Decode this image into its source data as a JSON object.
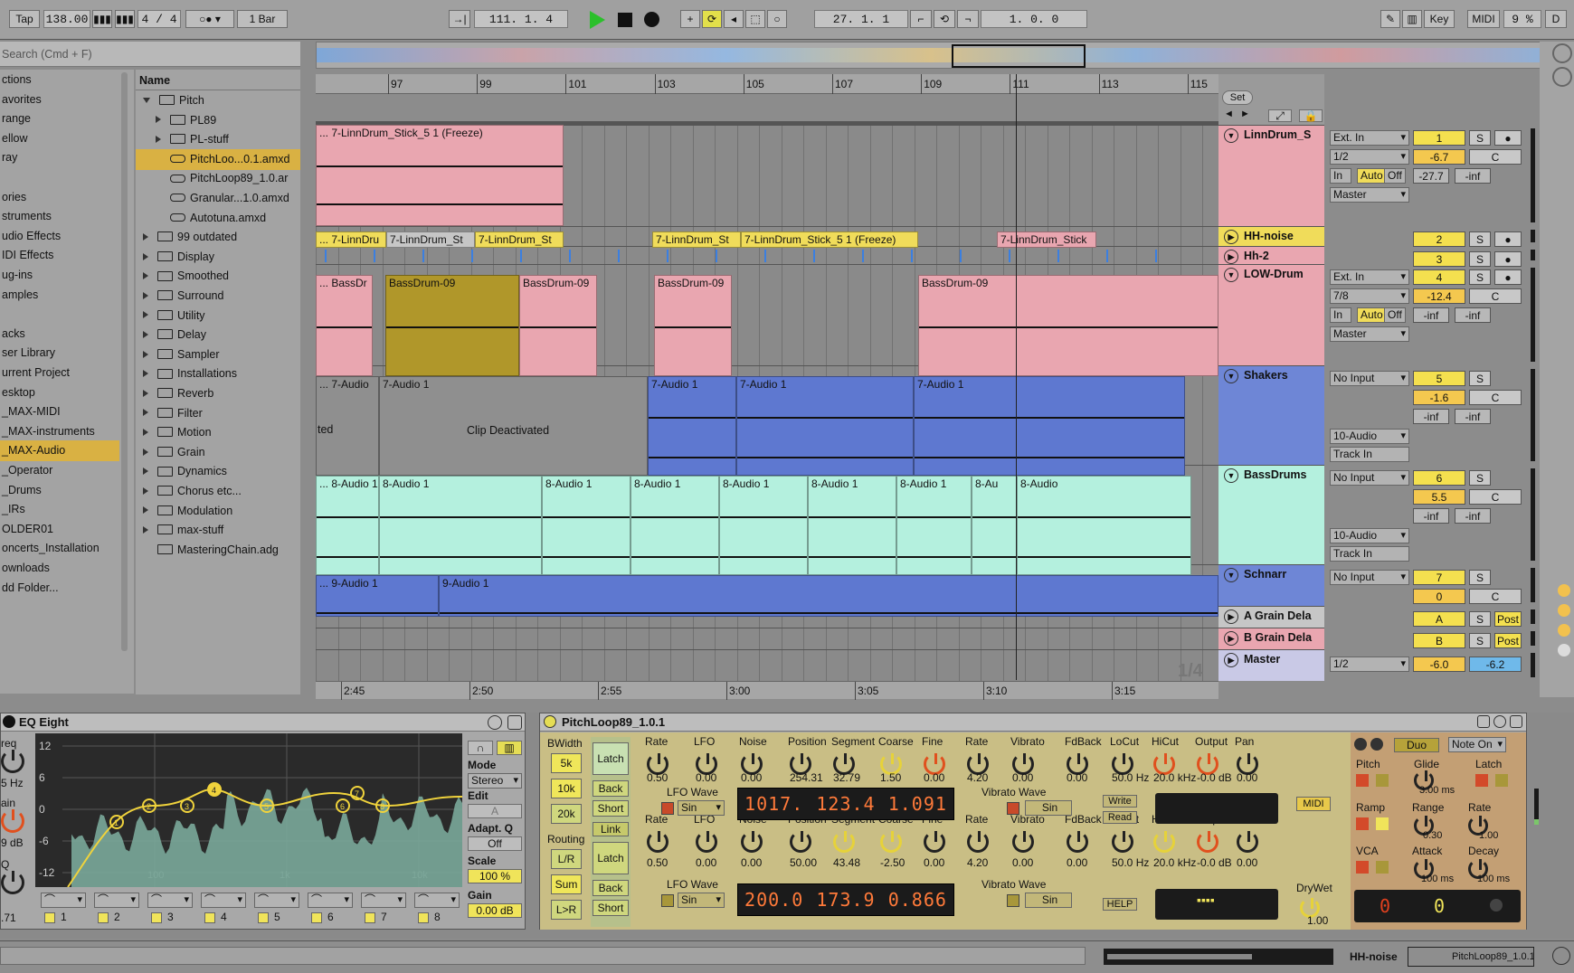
{
  "toolbar": {
    "tap": "Tap",
    "tempo": "138.00",
    "sig": "4 / 4",
    "quant": "1 Bar",
    "arr_pos": "111.  1.  4",
    "punch_pos": "27.  1.  1",
    "loop_len": "1.  0.  0",
    "key": "Key",
    "midi": "MIDI",
    "cpu": "9 %",
    "d": "D"
  },
  "browser": {
    "search_placeholder": "Search (Cmd + F)",
    "name_header": "Name",
    "places": [
      "ctions",
      "avorites",
      "range",
      "ellow",
      "ray",
      "",
      "ories",
      "struments",
      "udio Effects",
      "IDI Effects",
      "ug-ins",
      "amples",
      "",
      "acks",
      "ser Library",
      "urrent Project",
      "esktop",
      "_MAX-MIDI",
      "_MAX-instruments",
      "_MAX-Audio",
      "_Operator",
      "_Drums",
      "_IRs",
      "OLDER01",
      "oncerts_Installation",
      "ownloads",
      "dd Folder..."
    ],
    "selected_place": "_MAX-Audio",
    "items": [
      {
        "label": "Pitch",
        "level": 0,
        "type": "folder-open"
      },
      {
        "label": "PL89",
        "level": 1,
        "type": "folder"
      },
      {
        "label": "PL-stuff",
        "level": 1,
        "type": "folder"
      },
      {
        "label": "PitchLoo...0.1.amxd",
        "level": 1,
        "type": "device",
        "selected": true
      },
      {
        "label": "PitchLoop89_1.0.ar",
        "level": 1,
        "type": "device"
      },
      {
        "label": "Granular...1.0.amxd",
        "level": 1,
        "type": "device"
      },
      {
        "label": "Autotuna.amxd",
        "level": 1,
        "type": "device"
      },
      {
        "label": "99 outdated",
        "level": 0,
        "type": "folder"
      },
      {
        "label": "Display",
        "level": 0,
        "type": "folder"
      },
      {
        "label": "Smoothed",
        "level": 0,
        "type": "folder"
      },
      {
        "label": "Surround",
        "level": 0,
        "type": "folder"
      },
      {
        "label": "Utility",
        "level": 0,
        "type": "folder"
      },
      {
        "label": "Delay",
        "level": 0,
        "type": "folder"
      },
      {
        "label": "Sampler",
        "level": 0,
        "type": "folder"
      },
      {
        "label": "Installations",
        "level": 0,
        "type": "folder"
      },
      {
        "label": "Reverb",
        "level": 0,
        "type": "folder"
      },
      {
        "label": "Filter",
        "level": 0,
        "type": "folder"
      },
      {
        "label": "Motion",
        "level": 0,
        "type": "folder"
      },
      {
        "label": "Grain",
        "level": 0,
        "type": "folder"
      },
      {
        "label": "Dynamics",
        "level": 0,
        "type": "folder"
      },
      {
        "label": "Chorus etc...",
        "level": 0,
        "type": "folder"
      },
      {
        "label": "Modulation",
        "level": 0,
        "type": "folder"
      },
      {
        "label": "max-stuff",
        "level": 0,
        "type": "folder"
      },
      {
        "label": "MasteringChain.adg",
        "level": 0,
        "type": "rack"
      }
    ]
  },
  "ruler": {
    "bars": [
      "97",
      "99",
      "101",
      "103",
      "105",
      "107",
      "109",
      "111",
      "113",
      "115"
    ],
    "times": [
      "2:45",
      "2:50",
      "2:55",
      "3:00",
      "3:05",
      "3:10",
      "3:15"
    ],
    "set": "Set",
    "grid": "1/4"
  },
  "tracks": [
    {
      "name": "LinnDrum_S",
      "num": "1",
      "vol": "-6.7",
      "pan": "C",
      "in": "Ext. In",
      "ch": "1/2",
      "mon": [
        "In",
        "Auto",
        "Off"
      ],
      "out": "Master",
      "peak": "-27.7",
      "peak2": "-inf",
      "color": "#e9a6b0"
    },
    {
      "name": "HH-noise",
      "num": "2",
      "color": "#f0dc5a"
    },
    {
      "name": "Hh-2",
      "num": "3",
      "color": "#e9a6b0"
    },
    {
      "name": "LOW-Drum",
      "num": "4",
      "vol": "-12.4",
      "pan": "C",
      "in": "Ext. In",
      "ch": "7/8",
      "mon": [
        "In",
        "Auto",
        "Off"
      ],
      "out": "Master",
      "peak": "-inf",
      "peak2": "-inf",
      "color": "#e9a6b0"
    },
    {
      "name": "Shakers",
      "num": "5",
      "vol": "-1.6",
      "pan": "C",
      "in": "No Input",
      "out": "10-Audio",
      "trackin": "Track In",
      "peak": "-inf",
      "peak2": "-inf",
      "color": "#6e86d6"
    },
    {
      "name": "BassDrums",
      "num": "6",
      "vol": "5.5",
      "pan": "C",
      "in": "No Input",
      "out": "10-Audio",
      "trackin": "Track In",
      "peak": "-inf",
      "peak2": "-inf",
      "color": "#b4f0de"
    },
    {
      "name": "Schnarr",
      "num": "7",
      "vol": "0",
      "pan": "C",
      "in": "No Input",
      "color": "#6e86d6"
    },
    {
      "name": "A Grain Dela",
      "num": "A",
      "post": "Post",
      "color": "#c6c6c6"
    },
    {
      "name": "B Grain Dela",
      "num": "B",
      "post": "Post",
      "color": "#e9a6b0"
    },
    {
      "name": "Master",
      "out": "1/2",
      "vol": "-6.0",
      "vol2": "-6.2",
      "color": "#c9c9e6"
    }
  ],
  "clips": {
    "t1": "... 7-LinnDrum_Stick_5 1 (Freeze)",
    "t2a": "... 7-LinnDru",
    "t2b": "7-LinnDrum_St",
    "t2c": "7-LinnDrum_St",
    "t2d": "7-LinnDrum_St",
    "t2e": "7-LinnDrum_Stick_5 1 (Freeze)",
    "t2f": "7-LinnDrum_Stick",
    "t4a": "... BassDr",
    "t4b": "BassDrum-09",
    "t4c": "BassDrum-09",
    "t4d": "BassDrum-09",
    "t4e": "BassDrum-09",
    "t5a": "... 7-Audio",
    "t5b": "7-Audio 1",
    "t5c": "7-Audio 1",
    "t5d": "7-Audio 1",
    "t5e": "7-Audio 1",
    "t5deact": "Clip Deactivated",
    "t5ted": "ted",
    "t6": [
      "... 8-Audio 1",
      "8-Audio 1",
      "8-Audio 1",
      "8-Audio 1",
      "8-Audio 1",
      "8-Audio 1",
      "8-Audio 1",
      "8-Au",
      "8-Audio"
    ],
    "t7a": "... 9-Audio 1",
    "t7b": "9-Audio 1"
  },
  "eq": {
    "title": "EQ Eight",
    "freq": "req",
    "freq_val": "5 Hz",
    "gain": "ain",
    "gain_val": "9 dB",
    "q": "Q",
    "q_val": ".71",
    "y_ticks": [
      "12",
      "6",
      "0",
      "-6",
      "-12"
    ],
    "x_ticks": [
      "100",
      "1k",
      "10k"
    ],
    "mode_label": "Mode",
    "mode": "Stereo",
    "edit_label": "Edit",
    "edit": "A",
    "adapt_label": "Adapt. Q",
    "adapt": "Off",
    "scale_label": "Scale",
    "scale": "100 %",
    "gain_label": "Gain",
    "gain_out": "0.00 dB",
    "bands": [
      "1",
      "2",
      "3",
      "4",
      "5",
      "6",
      "7",
      "8"
    ]
  },
  "pitchloop": {
    "title": "PitchLoop89_1.0.1",
    "bwidth": "BWidth",
    "bw_btns": [
      "5k",
      "10k",
      "20k"
    ],
    "routing": "Routing",
    "route_btns": [
      "L/R",
      "Sum",
      "L>R"
    ],
    "latch": "Latch",
    "back": "Back",
    "short": "Short",
    "link": "Link",
    "row1": {
      "labels": [
        "Rate",
        "LFO",
        "Noise",
        "Position",
        "Segment",
        "Coarse",
        "Fine",
        "Rate",
        "Vibrato",
        "FdBack",
        "LoCut",
        "HiCut",
        "Output",
        "Pan"
      ],
      "values": [
        "0.50",
        "0.00",
        "0.00",
        "254.31",
        "32.79",
        "1.50",
        "0.00",
        "4.20",
        "0.00",
        "0.00",
        "50.0 Hz",
        "20.0 kHz",
        "-0.0 dB",
        "0.00"
      ],
      "lcd": [
        "1017.",
        "123.4",
        "1.091"
      ]
    },
    "row2": {
      "labels": [
        "Rate",
        "LFO",
        "Noise",
        "Position",
        "Segment",
        "Coarse",
        "Fine",
        "Rate",
        "Vibrato",
        "FdBack",
        "LoCut",
        "HiCut",
        "Output",
        "Pan"
      ],
      "values": [
        "0.50",
        "0.00",
        "0.00",
        "50.00",
        "43.48",
        "-2.50",
        "0.00",
        "4.20",
        "0.00",
        "0.00",
        "50.0 Hz",
        "20.0 kHz",
        "-0.0 dB",
        "0.00"
      ],
      "lcd": [
        "200.0",
        "173.9",
        "0.866"
      ]
    },
    "lfo_wave": "LFO Wave",
    "vib_wave": "Vibrato Wave",
    "sin": "Sin",
    "write": "Write",
    "read": "Read",
    "help": "HELP",
    "midi": "MIDI",
    "drywet": "DryWet",
    "drywet_val": "1.00",
    "duo": "Duo",
    "noteon": "Note On",
    "pitch": "Pitch",
    "glide": "Glide",
    "glide_val": "3.00 ms",
    "latch2": "Latch",
    "ramp": "Ramp",
    "range": "Range",
    "range_val": "0.30",
    "rate2": "Rate",
    "rate2_val": "1.00",
    "vca": "VCA",
    "attack": "Attack",
    "attack_val": "100 ms",
    "decay": "Decay",
    "decay_val": "100 ms",
    "red_lcd": [
      "0",
      "0"
    ]
  },
  "status": {
    "track": "HH-noise",
    "device": "PitchLoop89_1.0.1"
  }
}
